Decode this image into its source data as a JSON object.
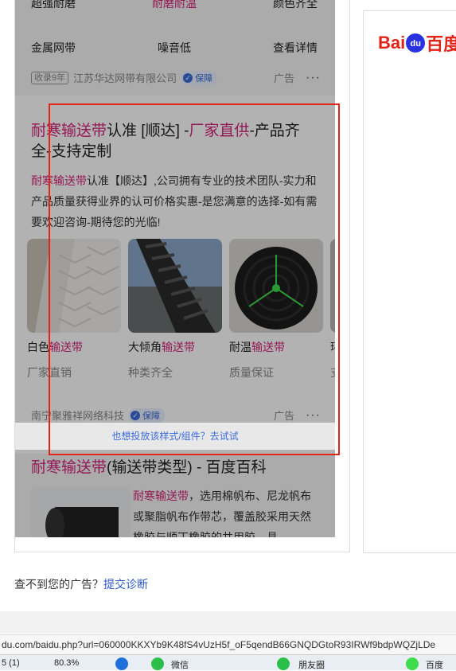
{
  "top_row_partial": [
    "超强耐磨",
    "耐磨耐温",
    "颜色齐全"
  ],
  "features_row": [
    "金属网带",
    "噪音低",
    "查看详情"
  ],
  "ad1_meta": {
    "years_tag": "收录9年",
    "company": "江苏华达网带有限公司",
    "guarantee": "保障",
    "ad_label": "广告",
    "more": "···"
  },
  "ad2": {
    "title_parts": [
      "耐寒输送带",
      "认准 [顺达] -",
      "厂家直供",
      "-产品齐全-支持定制"
    ],
    "desc_parts": [
      "耐寒输送带",
      "认准【顺达】,公司拥有专业的技术团队-实力和产品质量获得业界的认可价格实惠-是您满意的选择-如有需要欢迎咨询-期待您的光临!"
    ],
    "items": [
      {
        "name_prefix": "白色",
        "name_suffix": "输送带",
        "sub": "厂家直销"
      },
      {
        "name_prefix": "大倾角",
        "name_suffix": "输送带",
        "sub": "种类齐全"
      },
      {
        "name_prefix": "耐温",
        "name_suffix": "输送带",
        "sub": "质量保证"
      },
      {
        "name_prefix": "环",
        "name_suffix": "",
        "sub": "支"
      }
    ],
    "company": "南宁聚雅祥网络科技",
    "guarantee": "保障",
    "ad_label": "广告",
    "more": "···"
  },
  "try_bar": "也想投放该样式/组件？去试试",
  "wiki": {
    "title_red": "耐寒输送带",
    "title_rest": "(输送带类型) - 百度百科",
    "text_red": "耐寒输送带",
    "text_rest": "，选用棉帆布、尼龙帆布或聚脂帆布作带芯，覆盖胶采用天然橡胶与顺丁橡胶的共用胶，具"
  },
  "right_logo": {
    "bai": "Bai",
    "du": "du",
    "rest": "百度"
  },
  "not_found": {
    "text": "查不到您的广告？",
    "link": "提交诊断"
  },
  "status_url": "du.com/baidu.php?url=060000KKXYb9K48fS4vUzH5f_oF5qendB66GNQDGtoR93IRWf9bdpWQZjLDe",
  "taskbar": {
    "item1": "5 (1)",
    "item2": "80.3%",
    "item3": "微信",
    "item4": "朋友圈",
    "item5": "百度"
  },
  "colors": {
    "accent_red": "#d4237a",
    "box_red": "#e2231a",
    "link_blue": "#2b58c5"
  }
}
